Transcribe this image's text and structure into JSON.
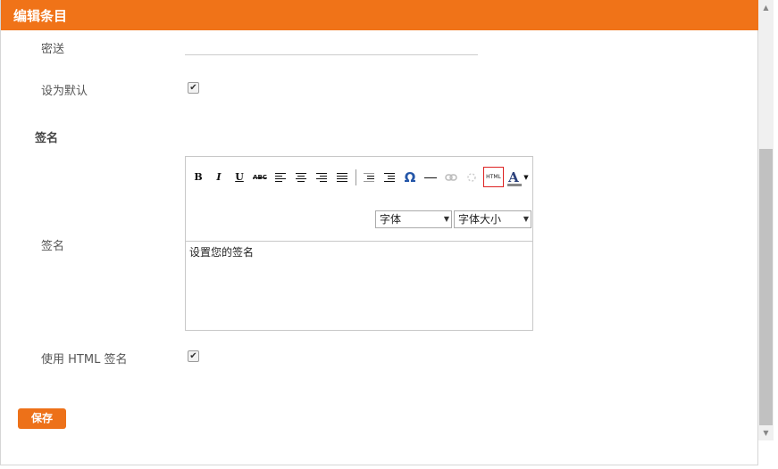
{
  "header": {
    "title": "编辑条目"
  },
  "fields": {
    "bcc_label": "密送",
    "set_default_label": "设为默认",
    "signature_section_title": "签名",
    "signature_label": "签名",
    "use_html_signature_label": "使用 HTML 签名"
  },
  "checkboxes": {
    "set_default_checked": true,
    "use_html_checked": true,
    "check_glyph": "✔"
  },
  "editor": {
    "toolbar": {
      "bold": "B",
      "italic": "I",
      "underline": "U",
      "strikethrough": "ABC",
      "special_char": "Ω",
      "html": "HTML",
      "font_color": "A"
    },
    "font_select": "字体",
    "font_size_select": "字体大小",
    "content": "设置您的签名"
  },
  "buttons": {
    "save": "保存"
  },
  "colors": {
    "accent": "#f07318",
    "save_button": "#ed7119"
  }
}
